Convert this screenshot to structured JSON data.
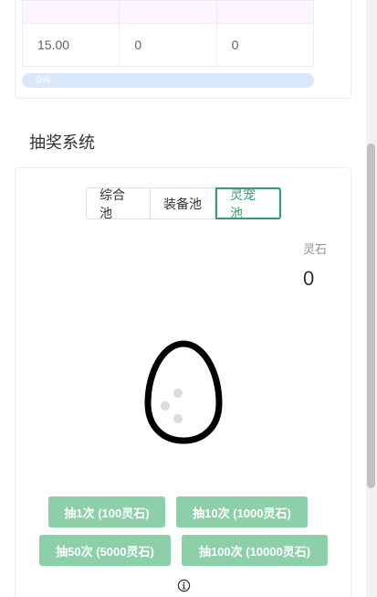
{
  "table": {
    "row": [
      "15.00",
      "0",
      "0"
    ]
  },
  "progress": {
    "value_percent": 0,
    "text": "0%"
  },
  "lottery": {
    "title": "抽奖系统",
    "tabs": [
      {
        "label": "综合池",
        "active": false
      },
      {
        "label": "装备池",
        "active": false
      },
      {
        "label": "灵宠池",
        "active": true
      }
    ],
    "currency": {
      "label": "灵石",
      "value": "0"
    },
    "buttons": [
      {
        "label": "抽1次 (100灵石)"
      },
      {
        "label": "抽10次 (1000灵石)"
      },
      {
        "label": "抽50次 (5000灵石)"
      },
      {
        "label": "抽100次 (10000灵石)"
      }
    ],
    "pet_icon": "egg-icon",
    "info_icon": "info-circle-icon"
  },
  "colors": {
    "accent": "#3a9a6b",
    "button_bg": "#8ccfa9",
    "progress_track": "#d9e8fb"
  }
}
